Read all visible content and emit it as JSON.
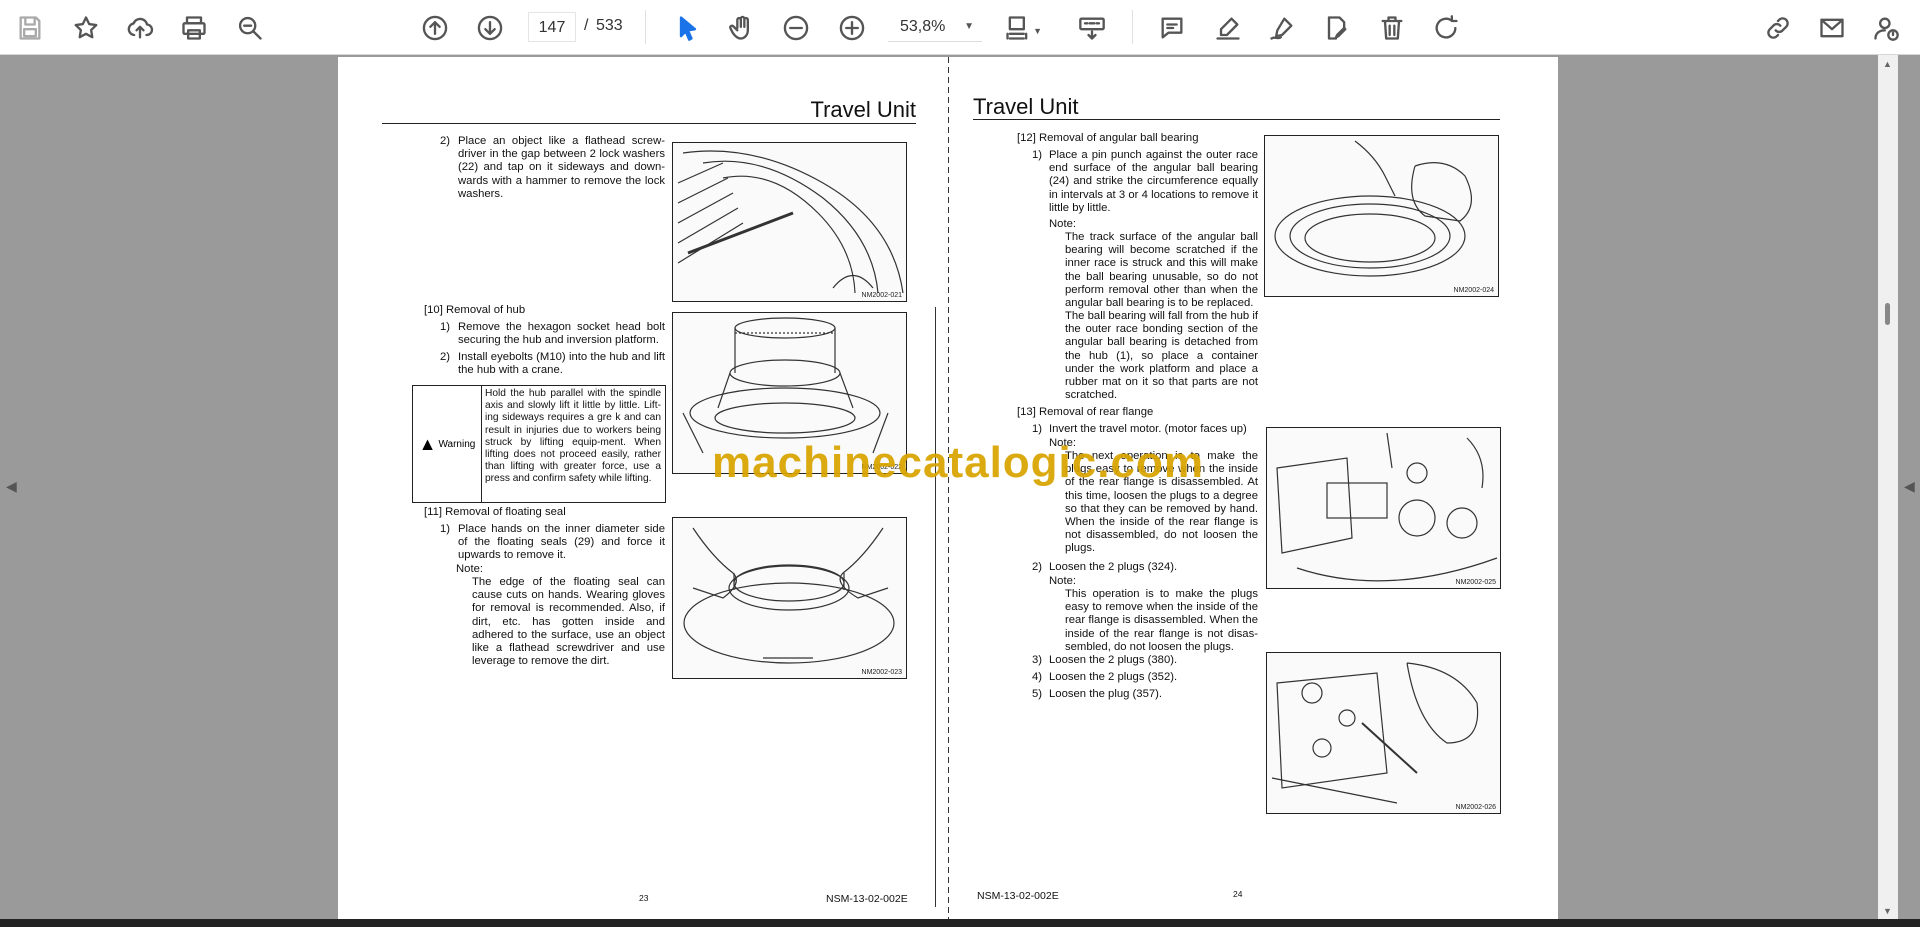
{
  "toolbar": {
    "current_page": "147",
    "page_separator": "/",
    "total_pages": "533",
    "zoom": "53,8%",
    "active_color": "#1a73e8"
  },
  "watermark": "machinecatalogic.com",
  "left_page": {
    "title": "Travel Unit",
    "step2_num": "2)",
    "step2_text": "Place an object like a flathead screw-driver in the gap between 2 lock washers (22) and tap on it sideways and down-wards with a hammer to remove the lock washers.",
    "fig1_id": "NM2002-021",
    "sec10": "[10] Removal of hub",
    "sec10_1_num": "1)",
    "sec10_1": "Remove the hexagon socket head bolt securing the hub and inversion platform.",
    "sec10_2_num": "2)",
    "sec10_2": "Install eyebolts (M10) into the hub and lift the hub with a crane.",
    "warning_label": "Warning",
    "warning_text": "Hold the hub parallel with the spindle axis and slowly lift it little by little. Lift-ing sideways requires a gre k and can result in injuries due to workers being struck by lifting equip-ment. When lifting does not proceed easily, rather than lifting with greater force, use a press and confirm safety while lifting.",
    "fig2_id": "NM2002-022",
    "sec11": "[11] Removal of floating seal",
    "sec11_1_num": "1)",
    "sec11_1": "Place hands on the inner diameter side of the floating seals (29) and force it upwards to remove it.",
    "note_label": "Note:",
    "sec11_note": "The edge of the floating seal can cause cuts on hands. Wearing gloves for removal is recommended. Also, if dirt, etc. has gotten inside and adhered to the surface, use an object like a flathead screwdriver and use leverage to remove the dirt.",
    "fig3_id": "NM2002-023",
    "page_number": "23",
    "footer": "NSM-13-02-002E"
  },
  "right_page": {
    "title": "Travel Unit",
    "sec12": "[12] Removal of angular ball bearing",
    "sec12_1_num": "1)",
    "sec12_1": "Place a pin punch against the outer race end surface of the angular ball bearing (24) and strike the circumference equally in intervals at 3 or 4 locations to remove it little by little.",
    "note_label": "Note:",
    "sec12_note1": "The track surface of the angular ball bearing will become scratched if the inner race is struck and this will make the ball bearing unusable, so do not perform removal other than when the angular ball bearing is to be replaced.",
    "sec12_note2": "The ball bearing will fall from the hub if the outer race bonding section of the angular ball bearing is detached from the hub (1), so place a container under the work platform and place a rubber mat on it so that parts are not scratched.",
    "fig4_id": "NM2002-024",
    "sec13": "[13] Removal of rear flange",
    "sec13_1_num": "1)",
    "sec13_1": "Invert the travel motor. (motor faces up)",
    "sec13_1_note": "The next operation is to make the plugs easy to remove when the inside of the rear flange is disassembled. At this time, loosen the plugs to a degree so that they can be removed by hand. When the inside of the rear flange is not disassembled, do not loosen the plugs.",
    "fig5_id": "NM2002-025",
    "sec13_2_num": "2)",
    "sec13_2": "Loosen the 2 plugs (324).",
    "sec13_2_note": "This operation is to make the plugs easy to remove when the inside of the rear flange is disassembled. When the inside of the rear flange is not disas-sembled, do not loosen the plugs.",
    "sec13_3_num": "3)",
    "sec13_3": "Loosen the 2 plugs (380).",
    "sec13_4_num": "4)",
    "sec13_4": "Loosen the 2 plugs (352).",
    "sec13_5_num": "5)",
    "sec13_5": "Loosen the plug (357).",
    "fig6_id": "NM2002-026",
    "page_number": "24",
    "footer": "NSM-13-02-002E"
  }
}
